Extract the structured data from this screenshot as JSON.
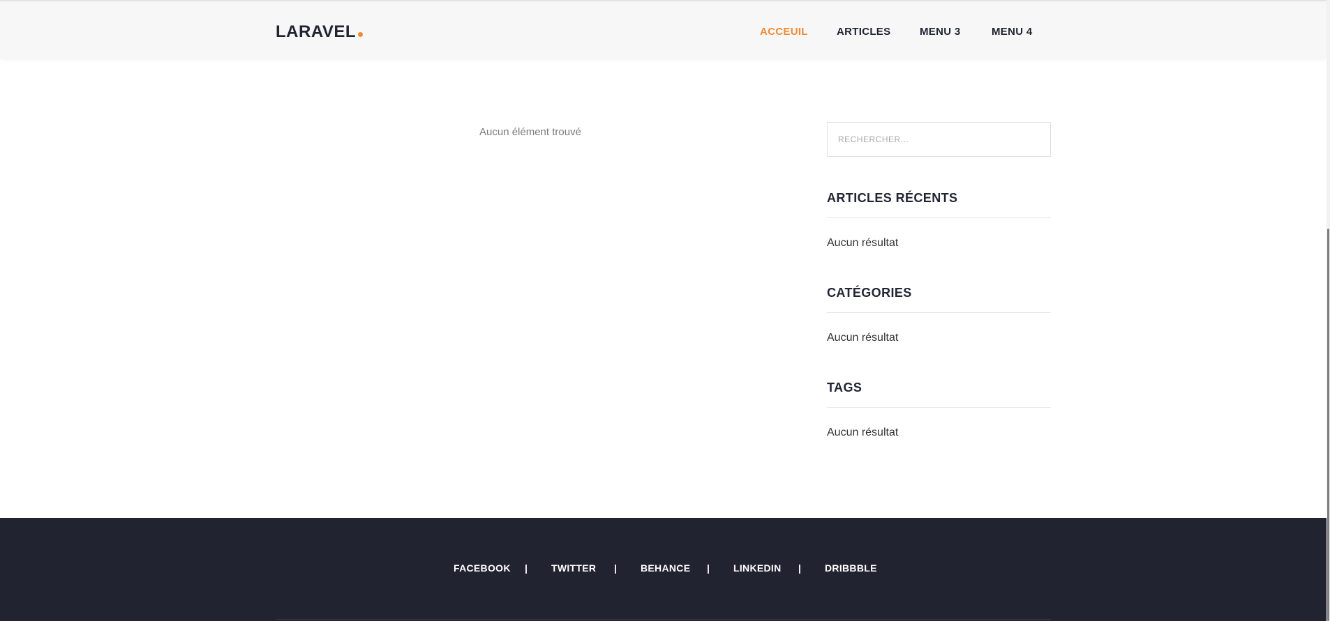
{
  "header": {
    "logo_text": "LARAVEL",
    "logo_dot_color": "#f28a34",
    "nav": [
      {
        "label": "ACCEUIL",
        "active": true
      },
      {
        "label": "ARTICLES",
        "active": false
      },
      {
        "label": "MENU 3",
        "active": false
      },
      {
        "label": "MENU 4",
        "active": false
      }
    ]
  },
  "main": {
    "empty_message": "Aucun élément trouvé"
  },
  "sidebar": {
    "search": {
      "placeholder": "RECHERCHER...",
      "value": ""
    },
    "widgets": [
      {
        "title": "ARTICLES RÉCENTS",
        "body": "Aucun résultat"
      },
      {
        "title": "CATÉGORIES",
        "body": "Aucun résultat"
      },
      {
        "title": "TAGS",
        "body": "Aucun résultat"
      }
    ]
  },
  "footer": {
    "social_links": [
      "FACEBOOK",
      "TWITTER",
      "BEHANCE",
      "LINKEDIN",
      "DRIBBBLE"
    ],
    "separator": "|"
  },
  "colors": {
    "accent": "#f28a34",
    "dark": "#222330",
    "header_bg": "#f7f7f7"
  }
}
